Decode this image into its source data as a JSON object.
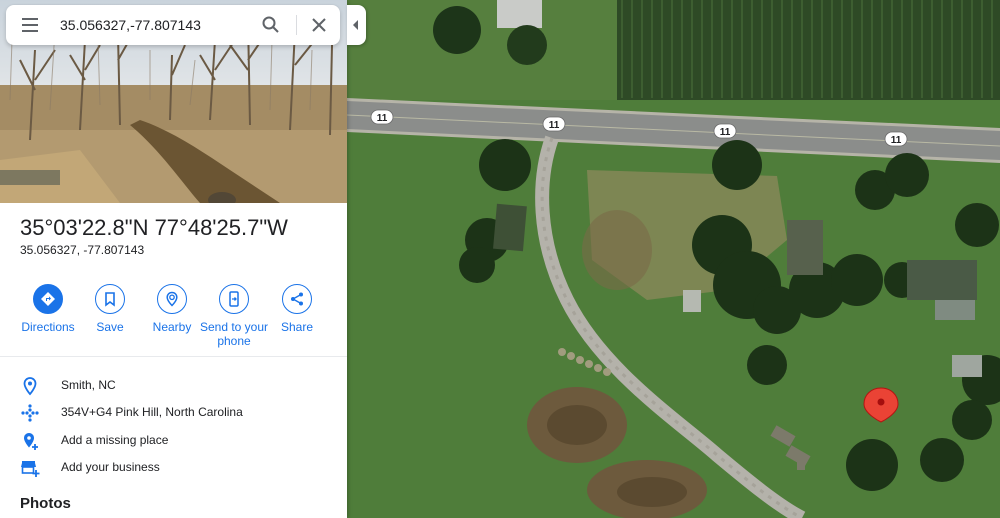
{
  "search": {
    "value": "35.056327,-77.807143"
  },
  "place": {
    "title": "35°03'22.8\"N 77°48'25.7\"W",
    "coords": "35.056327, -77.807143"
  },
  "actions": [
    {
      "label": "Directions",
      "icon": "directions-icon"
    },
    {
      "label": "Save",
      "icon": "bookmark-icon"
    },
    {
      "label": "Nearby",
      "icon": "nearby-icon"
    },
    {
      "label": "Send to your phone",
      "icon": "send-to-phone-icon"
    },
    {
      "label": "Share",
      "icon": "share-icon"
    }
  ],
  "info": [
    {
      "text": "Smith, NC",
      "icon": "location-pin-icon"
    },
    {
      "text": "354V+G4 Pink Hill, North Carolina",
      "icon": "plus-code-icon"
    },
    {
      "text": "Add a missing place",
      "icon": "add-place-icon"
    },
    {
      "text": "Add your business",
      "icon": "add-business-icon"
    }
  ],
  "photos_heading": "Photos",
  "map": {
    "road_shields": [
      "11",
      "11",
      "11",
      "11"
    ],
    "colors": {
      "accent": "#1a73e8",
      "marker": "#ea4335",
      "grass": "#4e7a39",
      "road": "#8a8c8a"
    }
  }
}
